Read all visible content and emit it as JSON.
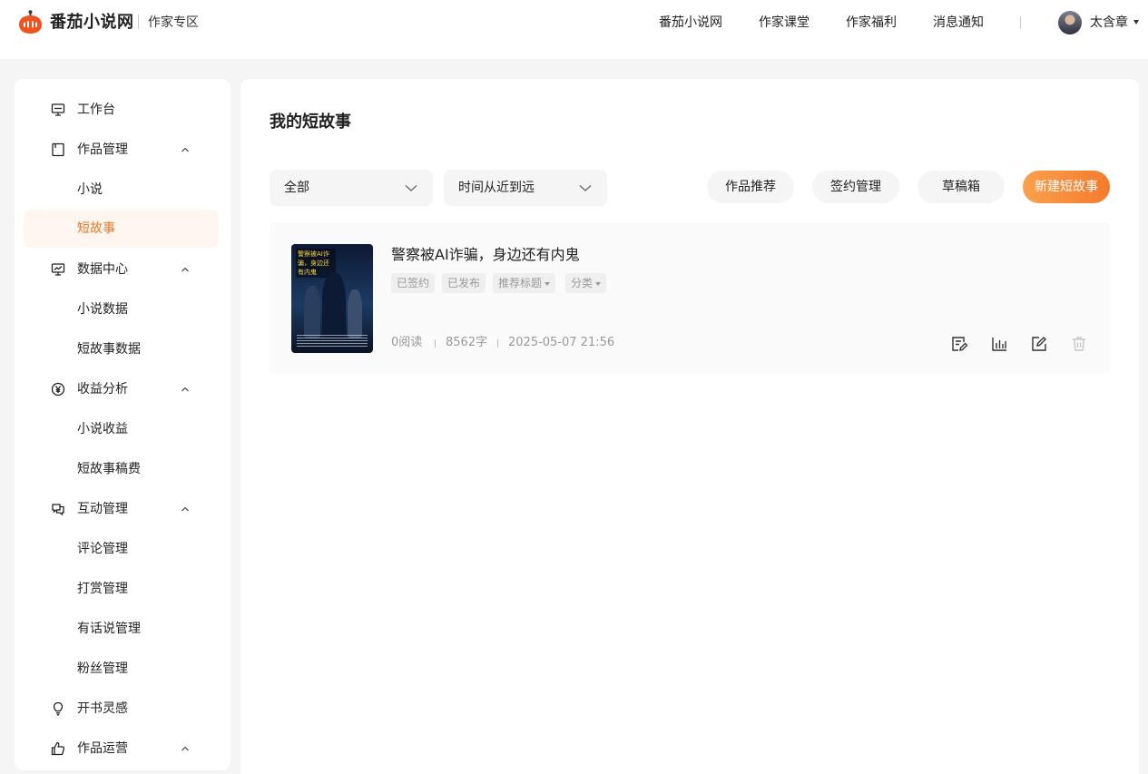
{
  "header": {
    "brand": "番茄小说网",
    "zone": "作家专区",
    "nav": [
      "番茄小说网",
      "作家课堂",
      "作家福利",
      "消息通知"
    ],
    "username": "太含章",
    "brand_color": "#e8551f"
  },
  "sidebar": {
    "items": [
      {
        "label": "工作台",
        "icon": "monitor-icon"
      },
      {
        "label": "作品管理",
        "icon": "book-icon",
        "expanded": true,
        "children": [
          "小说",
          "短故事"
        ]
      },
      {
        "label": "数据中心",
        "icon": "chart-monitor-icon",
        "expanded": true,
        "children": [
          "小说数据",
          "短故事数据"
        ]
      },
      {
        "label": "收益分析",
        "icon": "yuan-icon",
        "expanded": true,
        "children": [
          "小说收益",
          "短故事稿费"
        ]
      },
      {
        "label": "互动管理",
        "icon": "chat-icon",
        "expanded": true,
        "children": [
          "评论管理",
          "打赏管理",
          "有话说管理",
          "粉丝管理"
        ]
      },
      {
        "label": "开书灵感",
        "icon": "lightbulb-icon"
      },
      {
        "label": "作品运营",
        "icon": "thumbs-up-icon",
        "expanded": true
      }
    ],
    "active": "短故事",
    "active_color": "#e8782a"
  },
  "main": {
    "title": "我的短故事",
    "filters": {
      "status": "全部",
      "sort": "时间从近到远"
    },
    "actions": {
      "recommend": "作品推荐",
      "contract": "签约管理",
      "drafts": "草稿箱",
      "create": "新建短故事"
    },
    "stories": [
      {
        "cover_title": "警察被AI诈骗，身边还有内鬼",
        "title": "警察被AI诈骗，身边还有内鬼",
        "tags": [
          "已签约",
          "已发布",
          "推荐标题",
          "分类"
        ],
        "reads": "0阅读",
        "words": "8562字",
        "time": "2025-05-07 21:56"
      }
    ]
  }
}
